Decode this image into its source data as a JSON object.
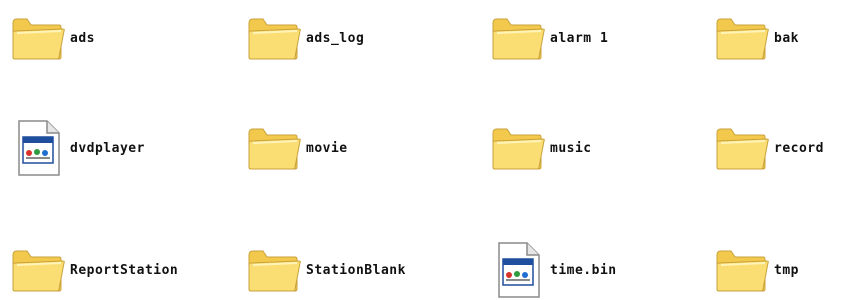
{
  "items": [
    {
      "label": "ads",
      "icon": "folder-icon"
    },
    {
      "label": "ads_log",
      "icon": "folder-icon"
    },
    {
      "label": "alarm 1",
      "icon": "folder-icon"
    },
    {
      "label": "bak",
      "icon": "folder-icon"
    },
    {
      "label": "dvdplayer",
      "icon": "executable-file-icon"
    },
    {
      "label": "movie",
      "icon": "folder-icon"
    },
    {
      "label": "music",
      "icon": "folder-icon"
    },
    {
      "label": "record",
      "icon": "folder-icon"
    },
    {
      "label": "ReportStation",
      "icon": "folder-icon"
    },
    {
      "label": "StationBlank",
      "icon": "folder-icon"
    },
    {
      "label": "time.bin",
      "icon": "executable-file-icon"
    },
    {
      "label": "tmp",
      "icon": "folder-icon"
    }
  ],
  "colors": {
    "folder_front": "#FADE74",
    "folder_back": "#F2C94C",
    "folder_outline": "#C9A23A",
    "file_bg": "#FFFFFF",
    "file_outline": "#8A8A8A",
    "file_header": "#1F4E9E"
  }
}
